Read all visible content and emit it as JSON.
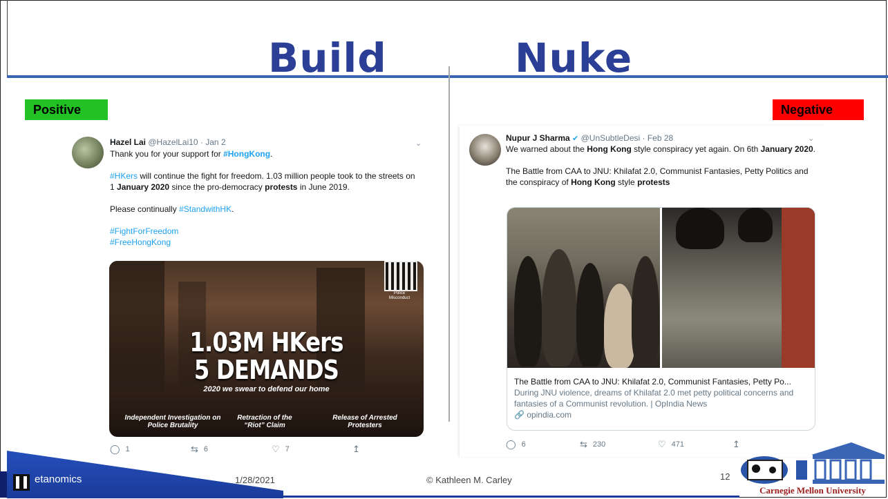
{
  "slide": {
    "title_left": "Build",
    "title_right": "Nuke",
    "tag_positive": "Positive",
    "tag_negative": "Negative",
    "colors": {
      "title": "#2a3f95",
      "positive": "#22c225",
      "negative": "#ff0000",
      "rule": "#3a64b6"
    }
  },
  "left_tweet": {
    "name": "Hazel Lai",
    "handle": "@HazelLai10 · Jan 2",
    "line1_pre": "Thank you for your support for ",
    "line1_tag": "#HongKong",
    "line1_post": ".",
    "p2_tag": "#HKers",
    "p2_a": " will continue the fight for freedom. 1.03 million people took to the streets on 1 ",
    "p2_bold1": "January 2020",
    "p2_b": " since the pro-democracy ",
    "p2_bold2": "protests",
    "p2_c": " in June 2019.",
    "p3_pre": "Please continually ",
    "p3_tag": "#StandwithHK",
    "p3_post": ".",
    "tag_a": "#FightForFreedom",
    "tag_b": "#FreeHongKong",
    "image": {
      "headline1": "1.03M HKers",
      "headline2": "5 DEMANDS",
      "subline": "2020 we swear to defend our home",
      "qr_label": "Police Misconduct",
      "demand1": "Independent Investigation on Police Brutality",
      "demand2": "Retraction of the “Riot” Claim",
      "demand3": "Release of Arrested Protesters"
    },
    "replies": "1",
    "retweets": "6",
    "likes": "7"
  },
  "right_tweet": {
    "name": "Nupur J Sharma",
    "handle": "@UnSubtleDesi · Feb 28",
    "l1_pre": "We warned about the ",
    "l1_bold": "Hong Kong",
    "l1_post": " style conspiracy yet again. On 6th ",
    "l1_bold2": "January 2020",
    "l1_end": ".",
    "p2_a": "The Battle from CAA to JNU: Khilafat 2.0, Communist Fantasies, Petty Politics and the conspiracy of ",
    "p2_bold": "Hong Kong",
    "p2_b": " style ",
    "p2_bold2": "protests",
    "card_title": "The Battle from CAA to JNU: Khilafat 2.0, Communist Fantasies, Petty Po...",
    "card_desc": "During JNU violence, dreams of Khilafat 2.0 met petty political concerns and fantasies of a Communist revolution. | OpIndia News",
    "card_domain": "opindia.com",
    "replies": "6",
    "retweets": "230",
    "likes": "471"
  },
  "footer": {
    "logo_text": "etanomics",
    "date": "1/28/2021",
    "copyright": "© Kathleen M. Carley",
    "page": "12",
    "cmu_text": "Carnegie Mellon University"
  }
}
